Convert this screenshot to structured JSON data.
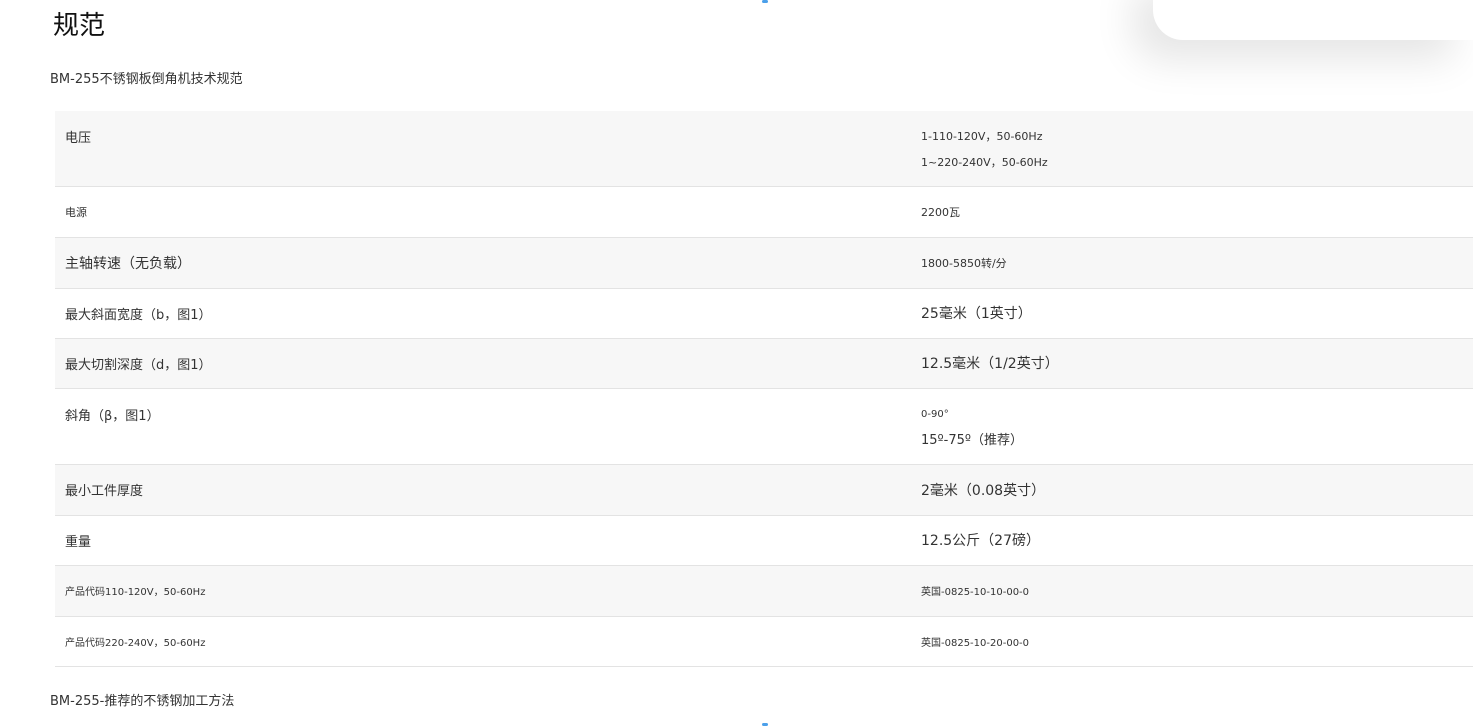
{
  "page": {
    "title": "规范"
  },
  "captions": {
    "table_caption": "BM-255不锈钢板倒角机技术规范",
    "next_section": "BM-255-推荐的不锈钢加工方法"
  },
  "specs": [
    {
      "label": "电压",
      "values": [
        "1-110-120V，50-60Hz",
        "1~220-240V，50-60Hz"
      ]
    },
    {
      "label": "电源",
      "values": [
        "2200瓦"
      ]
    },
    {
      "label": "主轴转速（无负载）",
      "values": [
        "1800-5850转/分"
      ]
    },
    {
      "label": "最大斜面宽度（b，图1）",
      "values": [
        "25毫米（1英寸）"
      ]
    },
    {
      "label": "最大切割深度（d，图1）",
      "values": [
        "12.5毫米（1/2英寸）"
      ]
    },
    {
      "label": "斜角（β，图1）",
      "values": [
        "0-90°",
        "15º-75º（推荐）"
      ]
    },
    {
      "label": "最小工件厚度",
      "values": [
        "2毫米（0.08英寸）"
      ]
    },
    {
      "label": "重量",
      "values": [
        "12.5公斤（27磅）"
      ]
    },
    {
      "label": "产品代码110-120V，50-60Hz",
      "values": [
        "英国-0825-10-10-00-0"
      ]
    },
    {
      "label": "产品代码220-240V，50-60Hz",
      "values": [
        "英国-0825-10-20-00-0"
      ]
    }
  ],
  "colors": {
    "row_shade": "#f7f7f7",
    "divider": "#e3e3e3",
    "accent": "#1e88e5"
  }
}
